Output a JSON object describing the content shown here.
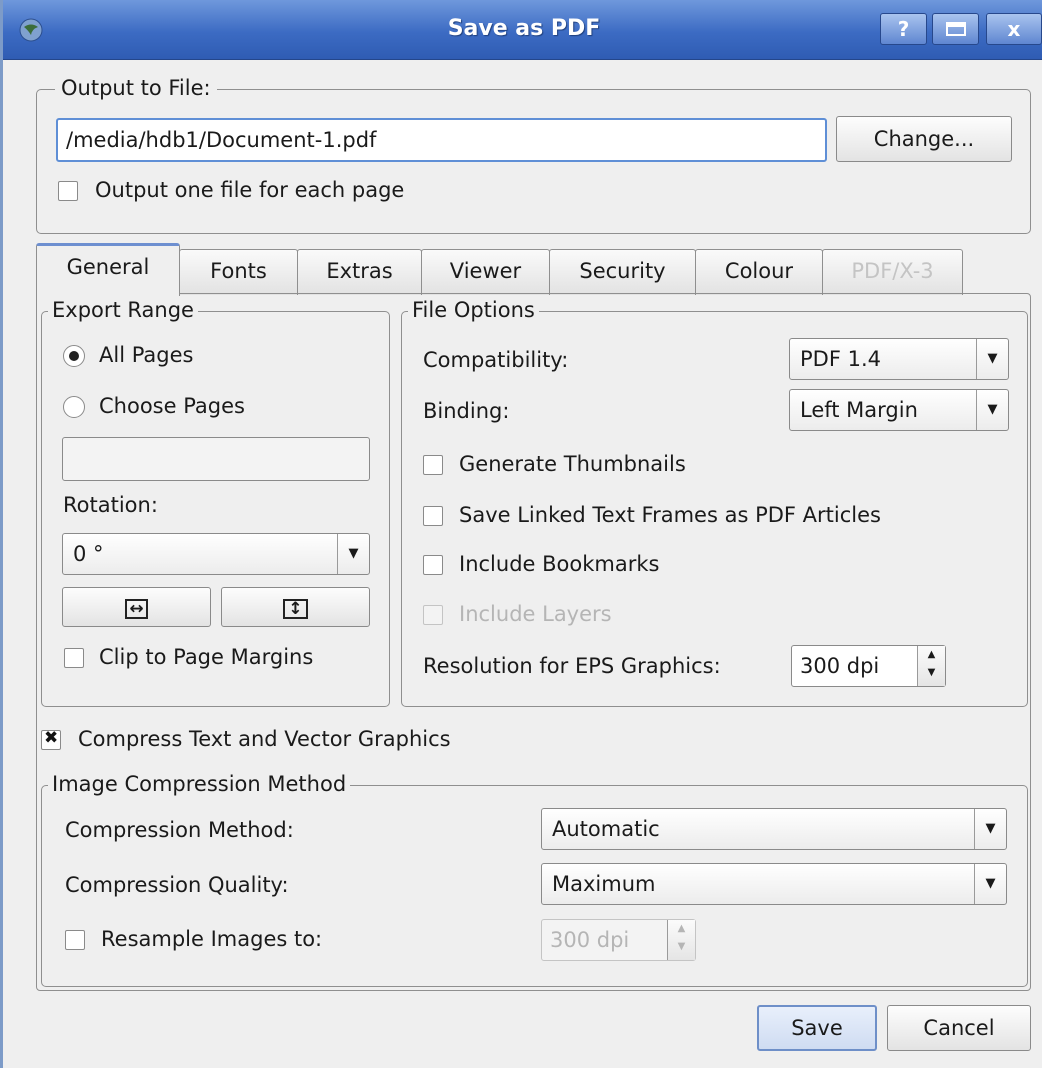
{
  "window": {
    "title": "Save as PDF",
    "help_glyph": "?",
    "close_glyph": "x"
  },
  "output": {
    "group_title": "Output to File:",
    "file_path": "/media/hdb1/Document-1.pdf",
    "change_button": "Change...",
    "one_file_per_page_label": "Output one file for each page",
    "one_file_per_page_checked": false
  },
  "tabs": [
    {
      "label": "General",
      "active": true,
      "enabled": true
    },
    {
      "label": "Fonts",
      "active": false,
      "enabled": true
    },
    {
      "label": "Extras",
      "active": false,
      "enabled": true
    },
    {
      "label": "Viewer",
      "active": false,
      "enabled": true
    },
    {
      "label": "Security",
      "active": false,
      "enabled": true
    },
    {
      "label": "Colour",
      "active": false,
      "enabled": true
    },
    {
      "label": "PDF/X-3",
      "active": false,
      "enabled": false
    }
  ],
  "export_range": {
    "group_title": "Export Range",
    "all_pages_label": "All Pages",
    "all_pages_selected": true,
    "choose_pages_label": "Choose Pages",
    "choose_pages_selected": false,
    "pages_value": "",
    "rotation_label": "Rotation:",
    "rotation_value": "0 °",
    "flip_horizontal_glyph": "↔",
    "flip_vertical_glyph": "↕",
    "clip_margins_label": "Clip to Page Margins",
    "clip_margins_checked": false
  },
  "file_options": {
    "group_title": "File Options",
    "compatibility_label": "Compatibility:",
    "compatibility_value": "PDF 1.4",
    "binding_label": "Binding:",
    "binding_value": "Left Margin",
    "thumbnails_label": "Generate Thumbnails",
    "thumbnails_checked": false,
    "linked_frames_label": "Save Linked Text Frames as PDF Articles",
    "linked_frames_checked": false,
    "bookmarks_label": "Include Bookmarks",
    "bookmarks_checked": false,
    "layers_label": "Include Layers",
    "layers_checked": false,
    "layers_enabled": false,
    "eps_resolution_label": "Resolution for EPS Graphics:",
    "eps_resolution_value": "300 dpi"
  },
  "compress": {
    "label": "Compress Text and Vector Graphics",
    "checked": true
  },
  "image_compression": {
    "group_title": "Image Compression Method",
    "method_label": "Compression Method:",
    "method_value": "Automatic",
    "quality_label": "Compression Quality:",
    "quality_value": "Maximum",
    "resample_label": "Resample Images to:",
    "resample_checked": false,
    "resample_value": "300 dpi"
  },
  "buttons": {
    "save": "Save",
    "cancel": "Cancel"
  },
  "colors": {
    "titlebar": "#3c6bc3",
    "dialog_bg": "#efefef",
    "focus": "#5f8fd6",
    "disabled_text": "#b5b5b5"
  }
}
